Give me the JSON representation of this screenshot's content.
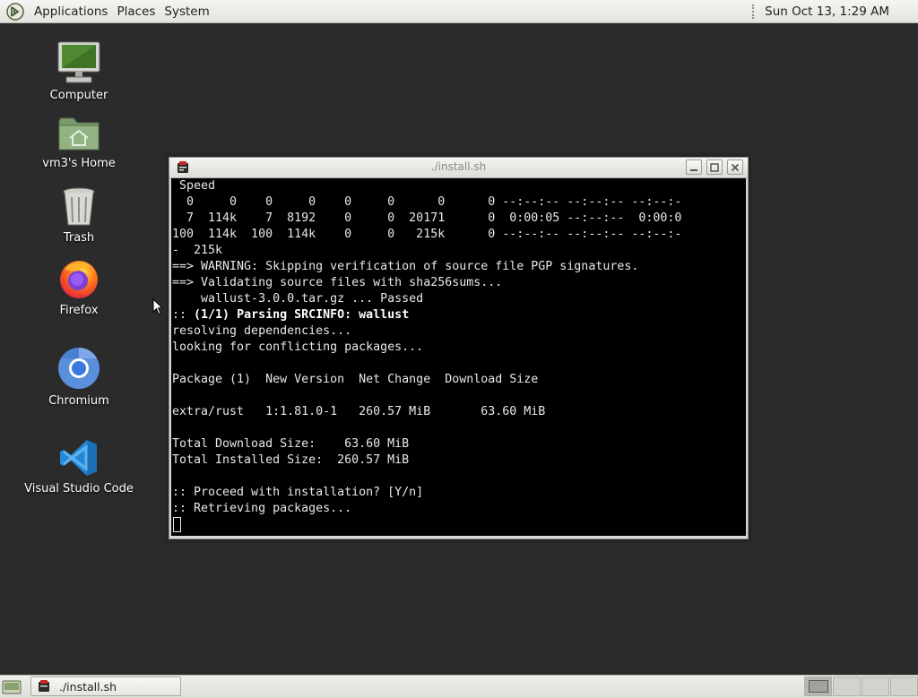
{
  "top_panel": {
    "menus": [
      "Applications",
      "Places",
      "System"
    ],
    "clock": "Sun Oct 13,  1:29 AM"
  },
  "desktop_icons": [
    {
      "label": "Computer",
      "icon": "computer-icon"
    },
    {
      "label": "vm3's Home",
      "icon": "home-folder-icon"
    },
    {
      "label": "Trash",
      "icon": "trash-icon"
    },
    {
      "label": "Firefox",
      "icon": "firefox-icon"
    },
    {
      "label": "Chromium",
      "icon": "chromium-icon"
    },
    {
      "label": "Visual Studio Code",
      "icon": "vscode-icon"
    }
  ],
  "window": {
    "title": "./install.sh"
  },
  "terminal": {
    "lines": [
      " Speed",
      "  0     0    0     0    0     0      0      0 --:--:-- --:--:-- --:--:-",
      "  7  114k    7  8192    0     0  20171      0  0:00:05 --:--:--  0:00:0",
      "100  114k  100  114k    0     0   215k      0 --:--:-- --:--:-- --:--:-",
      "-  215k",
      "==> WARNING: Skipping verification of source file PGP signatures.",
      "==> Validating source files with sha256sums...",
      "    wallust-3.0.0.tar.gz ... Passed",
      ":: (1/1) Parsing SRCINFO: wallust",
      "resolving dependencies...",
      "looking for conflicting packages...",
      "",
      "Package (1)  New Version  Net Change  Download Size",
      "",
      "extra/rust   1:1.81.0-1   260.57 MiB       63.60 MiB",
      "",
      "Total Download Size:    63.60 MiB",
      "Total Installed Size:  260.57 MiB",
      "",
      ":: Proceed with installation? [Y/n]",
      ":: Retrieving packages...",
      ""
    ],
    "bold_line_index": 8
  },
  "taskbar": {
    "task_label": "./install.sh",
    "workspaces": 4,
    "active_workspace": 1
  }
}
